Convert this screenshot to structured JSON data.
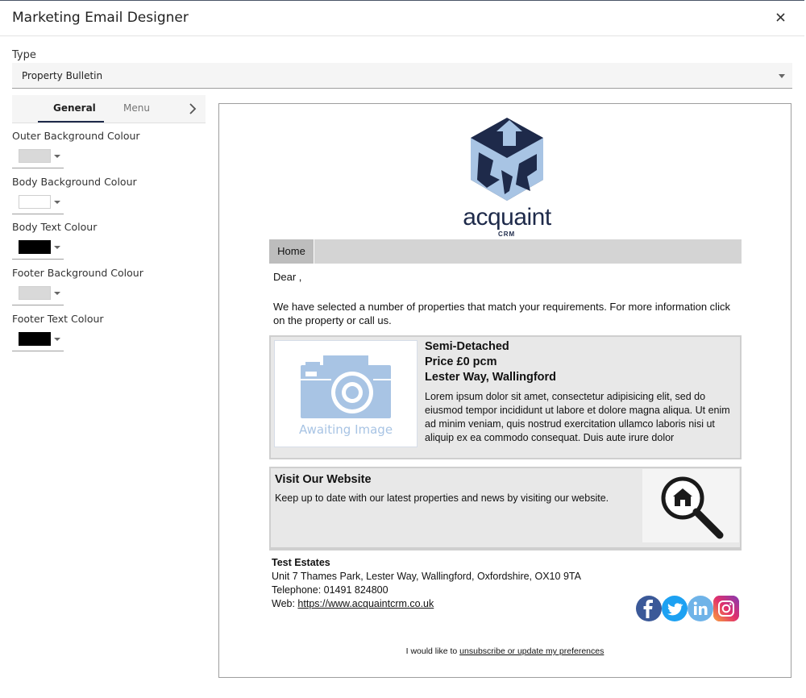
{
  "window": {
    "title": "Marketing Email Designer",
    "close_icon": "close-icon"
  },
  "type_field": {
    "label": "Type",
    "selected": "Property Bulletin"
  },
  "tabs": [
    {
      "label": "General",
      "active": true
    },
    {
      "label": "Menu",
      "active": false
    }
  ],
  "colour_fields": [
    {
      "label": "Outer Background Colour",
      "value": "#d9d9d9"
    },
    {
      "label": "Body Background Colour",
      "value": "#ffffff"
    },
    {
      "label": "Body Text Colour",
      "value": "#000000"
    },
    {
      "label": "Footer Background Colour",
      "value": "#d9d9d9"
    },
    {
      "label": "Footer Text Colour",
      "value": "#000000"
    }
  ],
  "email": {
    "logo_text": "acquaint",
    "logo_sub": "CRM",
    "nav": [
      "Home"
    ],
    "greeting": "Dear ,",
    "intro": "We have selected a number of properties that match your requirements. For more information click on the property or call us.",
    "property": {
      "image_caption": "Awaiting Image",
      "type": "Semi-Detached",
      "price": "Price £0 pcm",
      "address": "Lester Way, Wallingford",
      "description": "Lorem ipsum dolor sit amet, consectetur adipisicing elit, sed do eiusmod tempor incididunt ut labore et dolore magna aliqua. Ut enim ad minim veniam, quis nostrud exercitation ullamco laboris nisi ut aliquip ex ea commodo consequat. Duis aute irure dolor"
    },
    "website_block": {
      "title": "Visit Our Website",
      "text": "Keep up to date with our latest properties and news by visiting our website."
    },
    "footer": {
      "company": "Test Estates",
      "address": "Unit 7 Thames Park, Lester Way, Wallingford, Oxfordshire, OX10 9TA",
      "telephone": "Telephone: 01491 824800",
      "web_prefix": "Web: ",
      "web_link": "https://www.acquaintcrm.co.uk",
      "unsub_prefix": "I would like to ",
      "unsub_link": "unsubscribe or update my preferences"
    },
    "social": [
      "facebook-icon",
      "twitter-icon",
      "linkedin-icon",
      "instagram-icon"
    ]
  }
}
